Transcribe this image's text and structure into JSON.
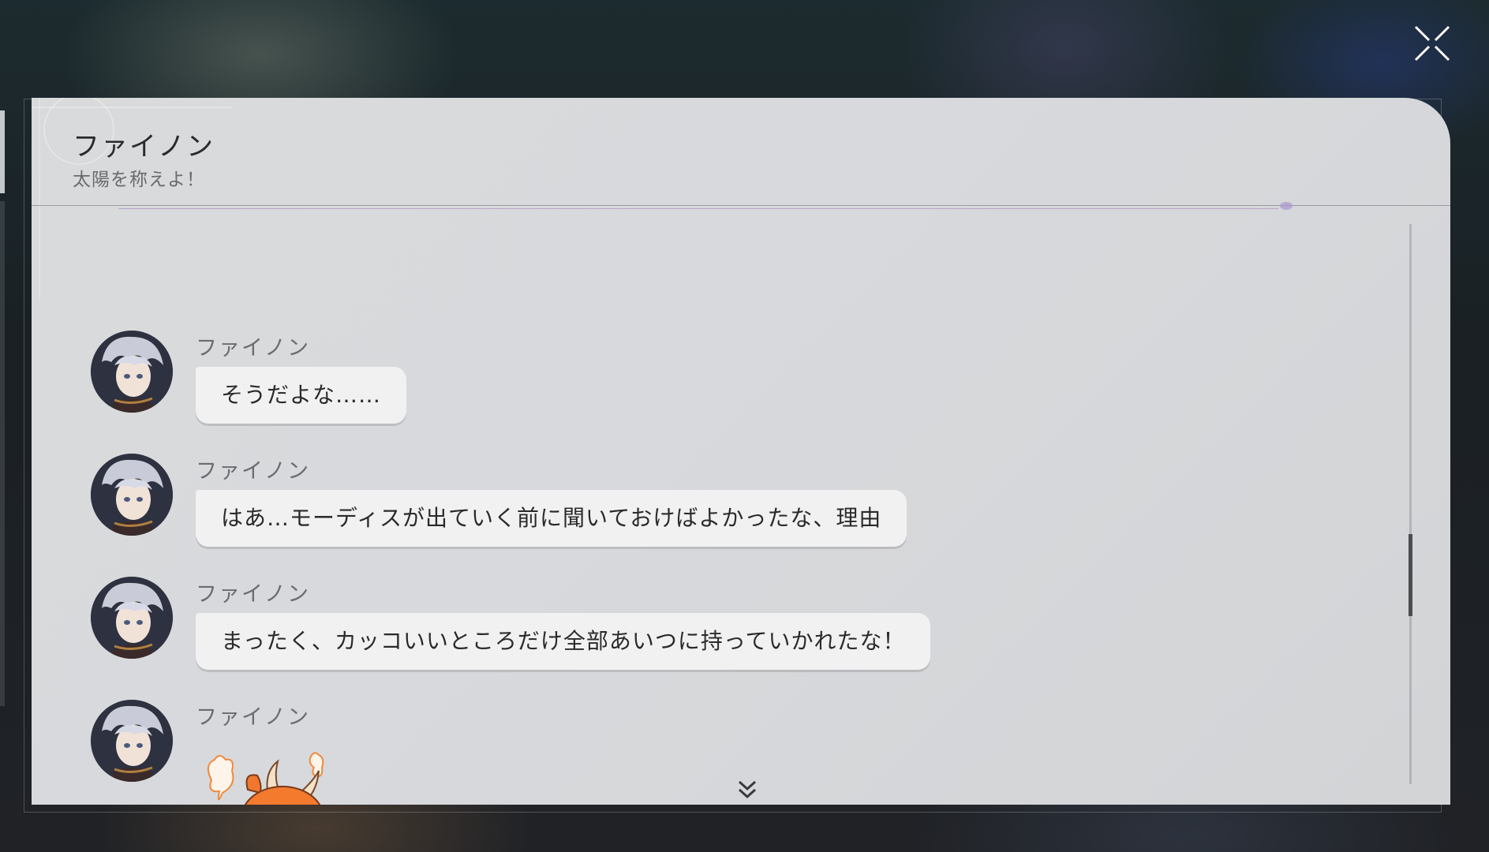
{
  "chat": {
    "title": "ファイノン",
    "subtitle": "太陽を称えよ！"
  },
  "messages": [
    {
      "sender": "ファイノン",
      "text": "そうだよな……",
      "type": "text"
    },
    {
      "sender": "ファイノン",
      "text": "はあ…モーディスが出ていく前に聞いておけばよかったな、理由",
      "type": "text"
    },
    {
      "sender": "ファイノン",
      "text": "まったく、カッコいいところだけ全部あいつに持っていかれたな！",
      "type": "text"
    },
    {
      "sender": "ファイノン",
      "type": "sticker",
      "sticker": "orange-dragon-creature-sticker"
    }
  ],
  "icons": {
    "close": "close-x-icon",
    "scroll_down": "double-chevron-down-icon"
  },
  "colors": {
    "panel_bg": "#d9dadb",
    "bubble_bg": "#f1f1f1",
    "text_primary": "#2a2a2c",
    "text_secondary": "#6c6c70"
  }
}
